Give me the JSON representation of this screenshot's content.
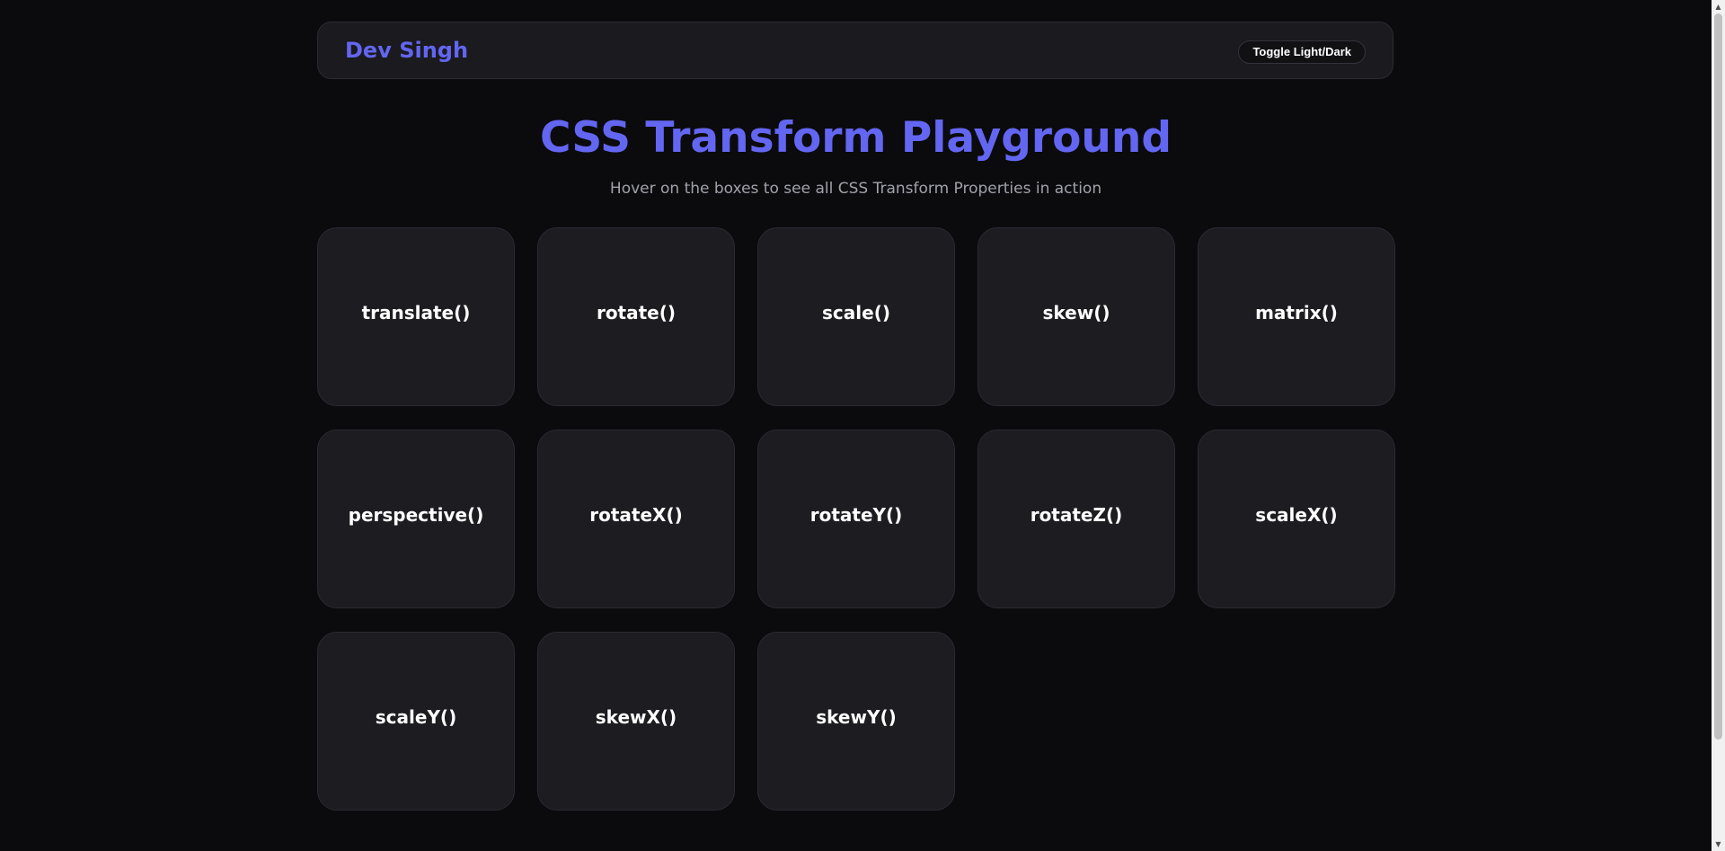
{
  "navbar": {
    "brand": "Dev Singh",
    "toggle_label": "Toggle Light/Dark"
  },
  "header": {
    "title": "CSS Transform Playground",
    "subtitle": "Hover on the boxes to see all CSS Transform Properties in action"
  },
  "cards": [
    {
      "label": "translate()"
    },
    {
      "label": "rotate()"
    },
    {
      "label": "scale()"
    },
    {
      "label": "skew()"
    },
    {
      "label": "matrix()"
    },
    {
      "label": "perspective()"
    },
    {
      "label": "rotateX()"
    },
    {
      "label": "rotateY()"
    },
    {
      "label": "rotateZ()"
    },
    {
      "label": "scaleX()"
    },
    {
      "label": "scaleY()"
    },
    {
      "label": "skewX()"
    },
    {
      "label": "skewY()"
    }
  ],
  "colors": {
    "accent": "#6366f1",
    "background": "#0b0b0e",
    "card": "#1c1c21",
    "subtitle": "#a1a1aa"
  },
  "scrollbar": {
    "up_icon": "scroll-up-arrow-icon",
    "down_icon": "scroll-down-arrow-icon"
  }
}
